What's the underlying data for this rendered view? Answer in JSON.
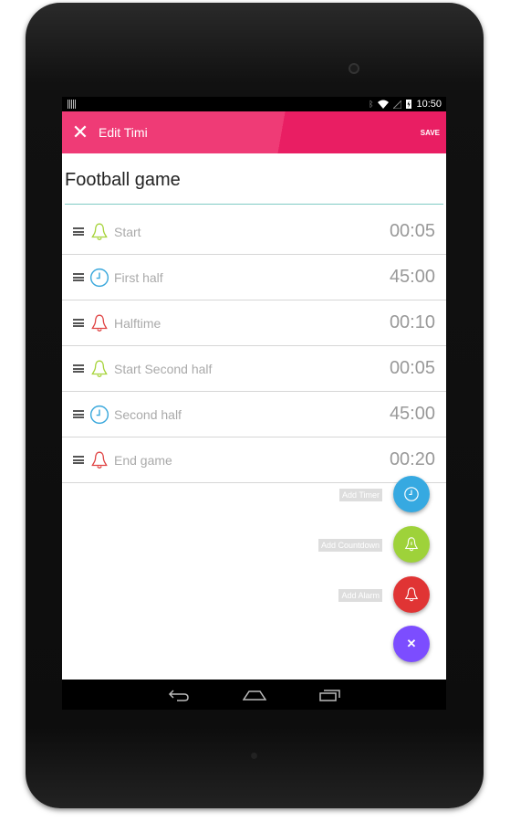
{
  "status_bar": {
    "time": "10:50",
    "icons": [
      "bluetooth-icon",
      "wifi-icon",
      "signal-icon",
      "battery-charging-icon"
    ]
  },
  "app_bar": {
    "title": "Edit Timi",
    "save_label": "SAVE",
    "close_icon": "close-icon"
  },
  "name_field": {
    "value": "Football game"
  },
  "items": [
    {
      "type": "countdown",
      "icon": "bell-icon",
      "label": "Start",
      "time": "00:05"
    },
    {
      "type": "timer",
      "icon": "clock-icon",
      "label": "First half",
      "time": "45:00"
    },
    {
      "type": "alarm",
      "icon": "bell-icon",
      "label": "Halftime",
      "time": "00:10"
    },
    {
      "type": "countdown",
      "icon": "bell-icon",
      "label": "Start Second half",
      "time": "00:05"
    },
    {
      "type": "timer",
      "icon": "clock-icon",
      "label": "Second half",
      "time": "45:00"
    },
    {
      "type": "alarm",
      "icon": "bell-icon",
      "label": "End game",
      "time": "00:20"
    }
  ],
  "fab_menu": {
    "timer": {
      "label": "Add Timer",
      "color": "#36a9e1"
    },
    "countdown": {
      "label": "Add Countdown",
      "color": "#9ed23a"
    },
    "alarm": {
      "label": "Add Alarm",
      "color": "#e03434"
    },
    "close": {
      "color": "#7c4dff",
      "icon": "close-icon"
    }
  },
  "colors": {
    "accent": "#e91e63",
    "timer": "#3aa8dc",
    "countdown": "#a6d33a",
    "alarm": "#e04444"
  }
}
